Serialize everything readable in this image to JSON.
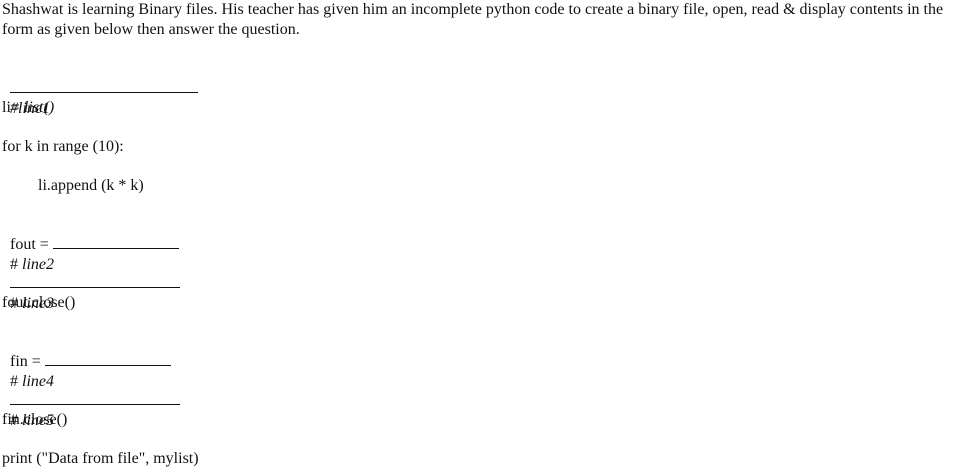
{
  "question": {
    "intro": "Shashwat is learning Binary files. His teacher has given him an incomplete python code to create a binary file, open, read & display contents in the form as given below then answer the question."
  },
  "code": {
    "line1_comment": "#line1",
    "li_prefix": "li= ",
    "li_call": "list()",
    "for_stmt": "for k in range (10):",
    "append_stmt": "li.append (k * k)",
    "fout_prefix": "fout = ",
    "line2_hash": "# ",
    "line2_comment": "line2",
    "line3_hash": "# ",
    "line3_comment": "line3",
    "fout_close": "fout.close()",
    "fin_prefix": "fin = ",
    "line4_hash": "# ",
    "line4_comment": "line4",
    "line5_hash": "# ",
    "line5_comment": "line5",
    "fin_close": "fin.close()",
    "print_stmt": "print (\"Data from file\", mylist)"
  }
}
